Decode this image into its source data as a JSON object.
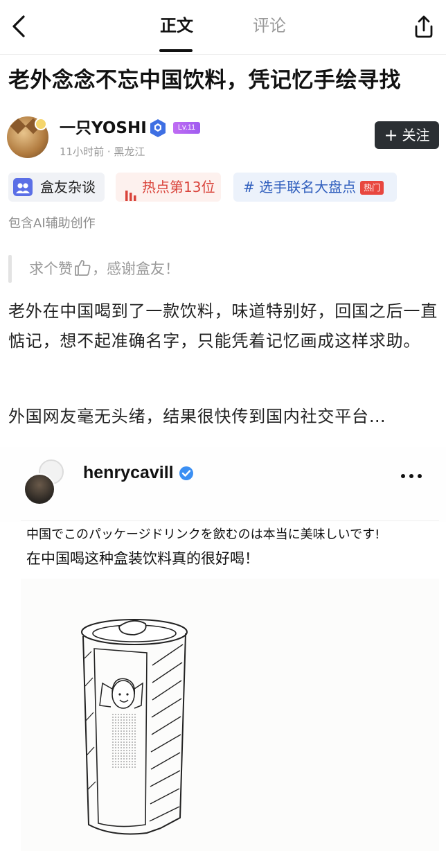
{
  "topbar": {
    "tab_main": "正文",
    "tab_comment": "评论"
  },
  "article": {
    "title": "老外念念不忘中国饮料，凭记忆手绘寻找",
    "author": {
      "name": "一只YOSHI",
      "level": "Lv.11",
      "meta": "11小时前 · 黑龙江",
      "follow_label": "关注"
    },
    "tags": {
      "group": "盒友杂谈",
      "hot_rank": "热点第13位",
      "topic": "# 选手联名大盘点",
      "topic_badge": "热门"
    },
    "ai_note": "包含AI辅助创作",
    "quote": {
      "before": "求个赞",
      "after": "，感谢盒友！"
    },
    "paragraphs": [
      "老外在中国喝到了一款饮料，味道特别好，回国之后一直惦记，想不起准确名字，只能凭着记忆画成这样求助。",
      "外国网友毫无头绪，结果很快传到国内社交平台…"
    ]
  },
  "embed": {
    "username": "henrycavill",
    "caption_jp": "中国でこのパッケージドリンクを飲むのは本当に美味しいです!",
    "caption_cn": "在中国喝这种盒装饮料真的很好喝！"
  },
  "colors": {
    "follow_bg": "#2b2f33",
    "hot_red": "#d9433a",
    "topic_blue": "#2f5ebd",
    "verify_blue": "#3b8ff3",
    "level_purple": "#b064f2"
  }
}
